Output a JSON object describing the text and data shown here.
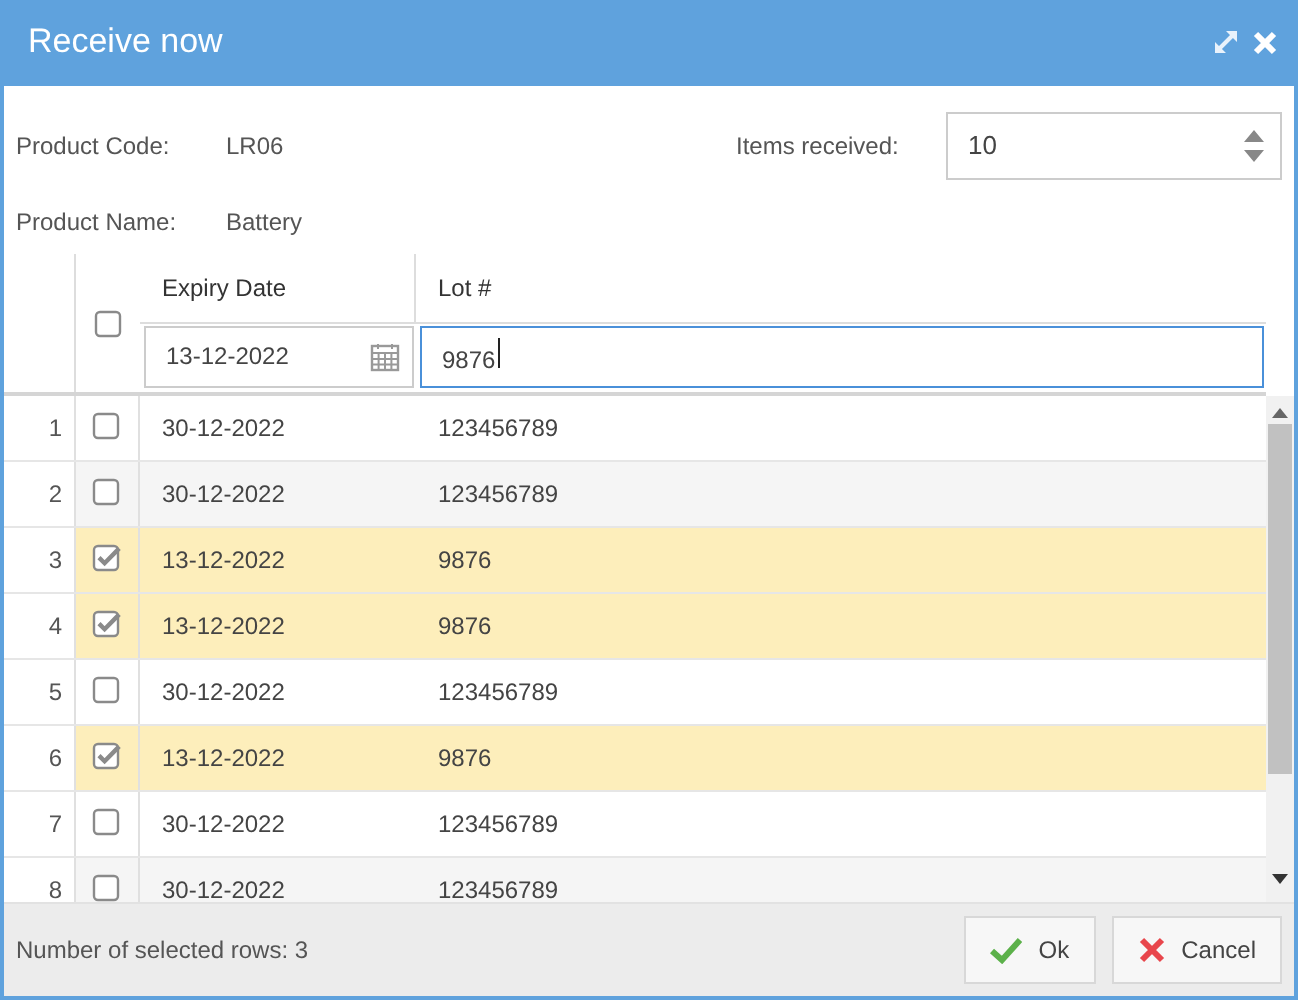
{
  "window": {
    "title": "Receive now"
  },
  "product_code": {
    "label": "Product Code:",
    "value": "LR06"
  },
  "product_name": {
    "label": "Product Name:",
    "value": "Battery"
  },
  "items_received": {
    "label": "Items received:",
    "value": "10"
  },
  "grid": {
    "select_all": {
      "checked": false
    },
    "columns": [
      "Expiry Date",
      "Lot #"
    ],
    "filters": [
      {
        "kind": "date",
        "value": "13-12-2022",
        "focused": false
      },
      {
        "kind": "text",
        "value": "9876",
        "focused": true
      }
    ],
    "rows": [
      {
        "number": "1",
        "checked": false,
        "expiry": "30-12-2022",
        "lot": "123456789"
      },
      {
        "number": "2",
        "checked": false,
        "expiry": "30-12-2022",
        "lot": "123456789"
      },
      {
        "number": "3",
        "checked": true,
        "expiry": "13-12-2022",
        "lot": "9876"
      },
      {
        "number": "4",
        "checked": true,
        "expiry": "13-12-2022",
        "lot": "9876"
      },
      {
        "number": "5",
        "checked": false,
        "expiry": "30-12-2022",
        "lot": "123456789"
      },
      {
        "number": "6",
        "checked": true,
        "expiry": "13-12-2022",
        "lot": "9876"
      },
      {
        "number": "7",
        "checked": false,
        "expiry": "30-12-2022",
        "lot": "123456789"
      },
      {
        "number": "8",
        "checked": false,
        "expiry": "30-12-2022",
        "lot": "123456789"
      }
    ]
  },
  "status": "Number of selected rows: 3",
  "buttons": [
    {
      "kind": "ok",
      "label": "Ok"
    },
    {
      "kind": "cancel",
      "label": "Cancel"
    }
  ]
}
